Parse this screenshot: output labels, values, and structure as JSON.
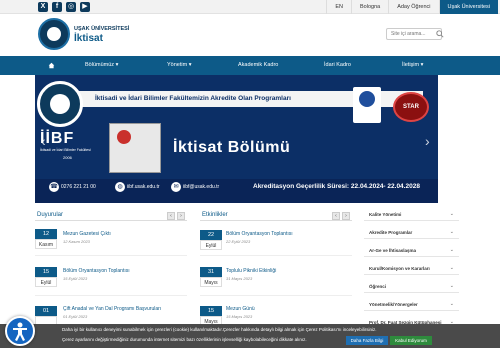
{
  "topbar": {
    "social": [
      {
        "name": "x-icon",
        "glyph": "X"
      },
      {
        "name": "facebook-icon",
        "glyph": "f"
      },
      {
        "name": "instagram-icon",
        "glyph": "◎"
      },
      {
        "name": "youtube-icon",
        "glyph": "▶"
      }
    ],
    "links": [
      "EN",
      "Bologna",
      "Aday Öğrenci",
      "Uşak Üniversitesi"
    ]
  },
  "header": {
    "university": "UŞAK ÜNİVERSİTESİ",
    "department": "İktisat",
    "search_placeholder": "Site içi arama..."
  },
  "nav": {
    "items": [
      "Bölümümüz ▾",
      "Yönetim ▾",
      "Akademik Kadro",
      "İdari Kadro",
      "İletişim ▾"
    ]
  },
  "banner": {
    "ribbon": "İktisadi ve İdari Bilimler Fakültemizin Akredite Olan Programları",
    "seal_text": "UŞAK 2006",
    "iibf": "İİBF",
    "iibf_sub": "İktisadi ve İdari Bilimler Fakültesi",
    "iibf_year": "2006",
    "title": "İktisat Bölümü",
    "star": "STAR",
    "phone": "0276 221 21 00",
    "site": "iibf.usak.edu.tr",
    "email": "iibf@usak.edu.tr",
    "accreditation": "Akreditasyon Geçerlilik Süresi: 22.04.2024- 22.04.2028"
  },
  "announcements": {
    "title": "Duyurular",
    "items": [
      {
        "day": "12",
        "month": "Kasım",
        "title": "Mezun Gazetesi Çıktı",
        "date": "12 Kasım 2023"
      },
      {
        "day": "15",
        "month": "Eylül",
        "title": "Bölüm Oryantasyon Toplantısı",
        "date": "15 Eylül 2023"
      },
      {
        "day": "01",
        "month": "",
        "title": "Çift Anadal ve Yan Dal Programı Başvuruları",
        "date": "01 Eylül 2023"
      }
    ]
  },
  "events": {
    "title": "Etkinlikler",
    "items": [
      {
        "day": "22",
        "month": "Eylül",
        "title": "Bölüm Oryantasyon Toplantısı",
        "date": "22 Eylül 2023"
      },
      {
        "day": "31",
        "month": "Mayıs",
        "title": "Toplulu Pikniki Etkinliği",
        "date": "31 Mayıs 2023"
      },
      {
        "day": "15",
        "month": "Mayıs",
        "title": "Mezun Günü",
        "date": "15 Mayıs 2023"
      }
    ]
  },
  "sidebar": {
    "items": [
      "Kalite Yönetimi",
      "Akredite Programlar",
      "Ar-Ge ve İhtisaslaşma",
      "Kurul/Komisyon ve Kararları",
      "Öğrenci",
      "Yönetmelik/Yönergeler",
      "Prof. Dr. Fuat Sezgin Kütüphanesi"
    ]
  },
  "cookie": {
    "line1": "Daha iyi bir kullanıcı deneyimi sunabilmek için çerezleri (cookie) kullanılmaktadır.Çerezler hakkında detaylı bilgi almak için Çerez Politikası'nı inceleyebilirsiniz.",
    "line2": "Çerez ayarlarını değiştirmediğiniz durumunda internet sitemizi bazı özelliklerinin işlevselliği kaybolabileceğini dikkate alınız.",
    "more_button": "Daha Fazla Bilgi",
    "accept_button": "Kabul Ediyorum"
  },
  "colors": {
    "primary": "#0d5a88",
    "dark": "#0d3a5c",
    "banner": "#0c2f66"
  }
}
